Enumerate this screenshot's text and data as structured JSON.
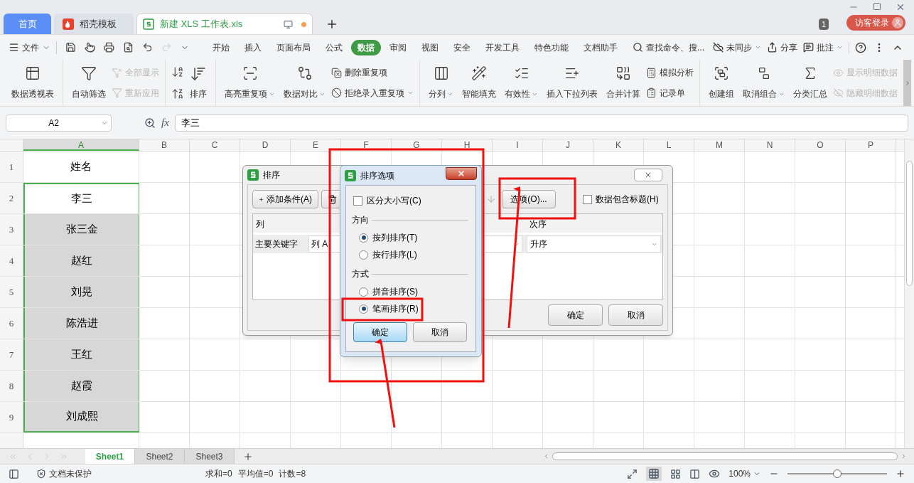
{
  "tabs": [
    {
      "kind": "home",
      "label": "首页",
      "selected": false
    },
    {
      "kind": "template",
      "label": "稻壳模板",
      "selected": false
    },
    {
      "kind": "doc",
      "label": "新建 XLS 工作表.xls",
      "selected": true
    }
  ],
  "badge": "1",
  "login": "访客登录",
  "file_menu": "文件",
  "menu_tabs": [
    {
      "label": "开始",
      "selected": false
    },
    {
      "label": "插入",
      "selected": false
    },
    {
      "label": "页面布局",
      "selected": false
    },
    {
      "label": "公式",
      "selected": false
    },
    {
      "label": "数据",
      "selected": true
    },
    {
      "label": "审阅",
      "selected": false
    },
    {
      "label": "视图",
      "selected": false
    },
    {
      "label": "安全",
      "selected": false
    },
    {
      "label": "开发工具",
      "selected": false
    },
    {
      "label": "特色功能",
      "selected": false
    },
    {
      "label": "文档助手",
      "selected": false
    }
  ],
  "search": "查找命令、搜...",
  "menu_right": [
    {
      "label": "未同步",
      "dropdown": true
    },
    {
      "label": "分享",
      "dropdown": false
    },
    {
      "label": "批注",
      "dropdown": true
    }
  ],
  "ribbon": [
    [
      {
        "kind": "large",
        "label": "数据透视表",
        "dropdown": false
      }
    ],
    [
      {
        "kind": "large",
        "label": "自动筛选",
        "dropdown": false
      },
      {
        "kind": "stack",
        "items": [
          {
            "label": "全部显示",
            "disabled": true,
            "dropdown": false
          },
          {
            "label": "重新应用",
            "disabled": true,
            "dropdown": false
          }
        ]
      }
    ],
    [
      {
        "kind": "sort",
        "label": "排序",
        "dropdown": false
      }
    ],
    [
      {
        "kind": "large",
        "label": "高亮重复项",
        "dropdown": true
      },
      {
        "kind": "large",
        "label": "数据对比",
        "dropdown": true
      },
      {
        "kind": "stack",
        "items": [
          {
            "label": "删除重复项",
            "disabled": false,
            "dropdown": false
          },
          {
            "label": "拒绝录入重复项",
            "disabled": false,
            "dropdown": true
          }
        ]
      }
    ],
    [
      {
        "kind": "large",
        "label": "分列",
        "dropdown": true
      },
      {
        "kind": "large",
        "label": "智能填充",
        "dropdown": false
      },
      {
        "kind": "large",
        "label": "有效性",
        "dropdown": true
      },
      {
        "kind": "large",
        "label": "插入下拉列表",
        "dropdown": false
      },
      {
        "kind": "large",
        "label": "合并计算",
        "dropdown": false
      },
      {
        "kind": "stack",
        "items": [
          {
            "label": "模拟分析",
            "disabled": false,
            "dropdown": false
          },
          {
            "label": "记录单",
            "disabled": false,
            "dropdown": false
          }
        ]
      }
    ],
    [
      {
        "kind": "large",
        "label": "创建组",
        "dropdown": false
      },
      {
        "kind": "large",
        "label": "取消组合",
        "dropdown": true
      },
      {
        "kind": "large",
        "label": "分类汇总",
        "dropdown": false
      },
      {
        "kind": "stack",
        "items": [
          {
            "label": "显示明细数据",
            "disabled": true,
            "dropdown": false
          },
          {
            "label": "隐藏明细数据",
            "disabled": true,
            "dropdown": false
          }
        ]
      }
    ]
  ],
  "name_box": "A2",
  "fx": "fx",
  "formula": "李三",
  "columns": [
    {
      "label": "A",
      "selected": true
    },
    {
      "label": "B",
      "selected": false
    },
    {
      "label": "C",
      "selected": false
    },
    {
      "label": "D",
      "selected": false
    },
    {
      "label": "E",
      "selected": false
    },
    {
      "label": "F",
      "selected": false
    },
    {
      "label": "G",
      "selected": false
    },
    {
      "label": "H",
      "selected": false
    },
    {
      "label": "I",
      "selected": false
    },
    {
      "label": "J",
      "selected": false
    },
    {
      "label": "K",
      "selected": false
    },
    {
      "label": "L",
      "selected": false
    },
    {
      "label": "M",
      "selected": false
    },
    {
      "label": "N",
      "selected": false
    },
    {
      "label": "O",
      "selected": false
    },
    {
      "label": "P",
      "selected": false
    }
  ],
  "rows": [
    {
      "number": "1",
      "value": "姓名",
      "selected": false,
      "active": false
    },
    {
      "number": "2",
      "value": "李三",
      "selected": true,
      "active": true
    },
    {
      "number": "3",
      "value": "张三金",
      "selected": true,
      "active": false
    },
    {
      "number": "4",
      "value": "赵红",
      "selected": true,
      "active": false
    },
    {
      "number": "5",
      "value": "刘晃",
      "selected": true,
      "active": false
    },
    {
      "number": "6",
      "value": "陈浩进",
      "selected": true,
      "active": false
    },
    {
      "number": "7",
      "value": "王红",
      "selected": true,
      "active": false
    },
    {
      "number": "8",
      "value": "赵霞",
      "selected": true,
      "active": false
    },
    {
      "number": "9",
      "value": "刘成熙",
      "selected": true,
      "active": false
    }
  ],
  "sheets": [
    {
      "label": "Sheet1",
      "selected": true
    },
    {
      "label": "Sheet2",
      "selected": false
    },
    {
      "label": "Sheet3",
      "selected": false
    }
  ],
  "status": {
    "protection": "文档未保护",
    "stats": [
      "求和=0",
      "平均值=0",
      "计数=8"
    ],
    "zoom": "100%",
    "zoom_slider": {
      "level": 0.5
    }
  },
  "sort_dialog": {
    "title": "排序",
    "add_button": "添加条件(A)",
    "options_button": "选项(O)...",
    "header_checkbox": {
      "label": "数据包含标题(H)",
      "checked": false
    },
    "col_header": "列",
    "order_header": "次序",
    "key_label": "主要关键字",
    "key_value": "列 A",
    "order_value": "升序",
    "ok": "确定",
    "cancel": "取消"
  },
  "options_dialog": {
    "title": "排序选项",
    "case_checkbox": {
      "label": "区分大小写(C)",
      "checked": false
    },
    "sections": [
      {
        "title": "方向",
        "options": [
          {
            "label": "按列排序(T)",
            "selected": true
          },
          {
            "label": "按行排序(L)",
            "selected": false
          }
        ]
      },
      {
        "title": "方式",
        "options": [
          {
            "label": "拼音排序(S)",
            "selected": false
          },
          {
            "label": "笔画排序(R)",
            "selected": true
          }
        ]
      }
    ],
    "ok": "确定",
    "cancel": "取消"
  }
}
